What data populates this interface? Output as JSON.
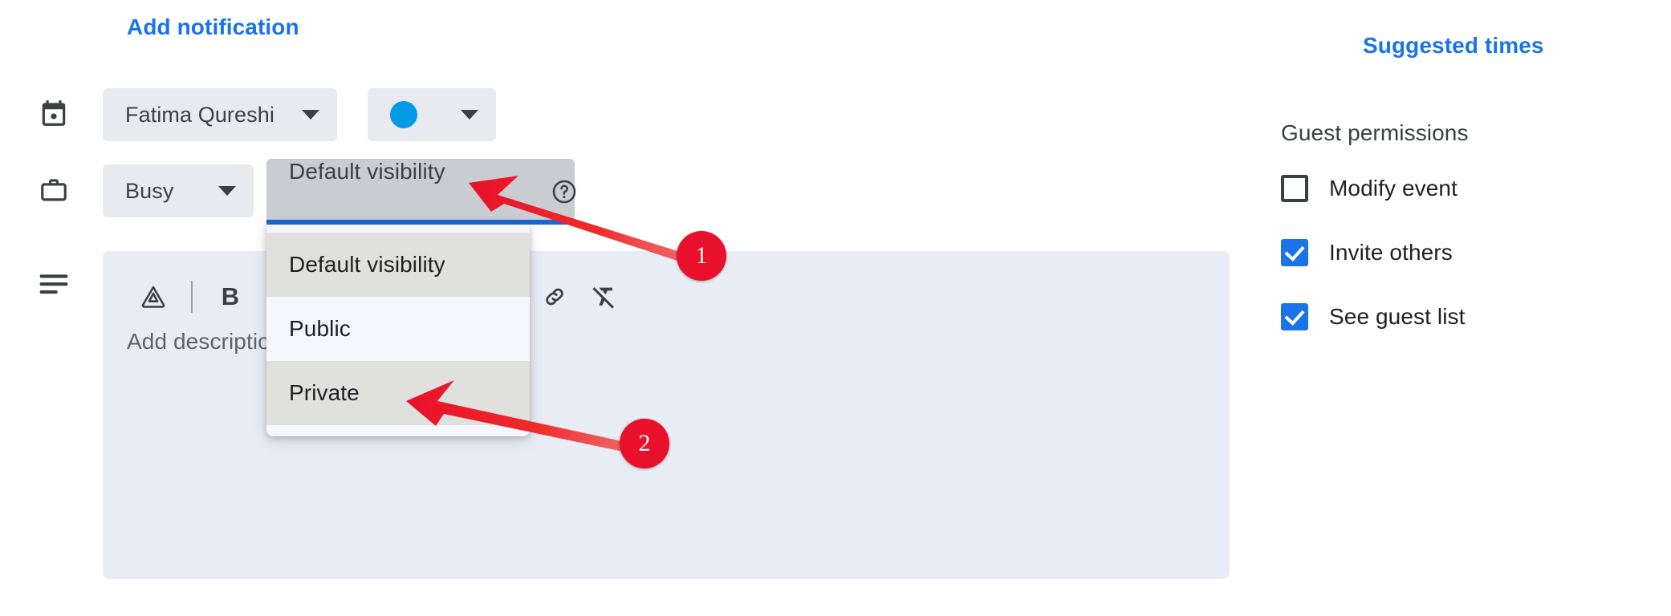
{
  "links": {
    "add_notification": "Add notification",
    "suggested_times": "Suggested times"
  },
  "colors": {
    "accent_blue": "#1a73e8",
    "underline_blue": "#1967d2",
    "chip_bg": "#e8eaf0",
    "active_chip_bg": "#c9ccd1",
    "menu_bg": "#f4f6fb",
    "menu_highlight": "#e0e0dd",
    "swatch": "#039be5",
    "marker_red": "#e8102a",
    "description_bg": "#e8ecf4"
  },
  "icons": {
    "calendar": "calendar-icon",
    "busy": "briefcase-icon",
    "description": "description-lines-icon",
    "help": "help-circle-icon",
    "drive": "google-drive-icon",
    "bold": "bold-icon",
    "link": "link-icon",
    "clear_format": "clear-formatting-icon"
  },
  "owner_select": {
    "value": "Fatima Qureshi",
    "caret": "chevron-down-icon"
  },
  "color_select": {
    "swatch_color": "#039be5",
    "caret": "chevron-down-icon"
  },
  "busy_select": {
    "value": "Busy",
    "caret": "chevron-down-icon"
  },
  "visibility_select": {
    "value": "Default visibility",
    "expanded": true,
    "options": [
      {
        "label": "Default visibility",
        "highlighted": true
      },
      {
        "label": "Public",
        "highlighted": false
      },
      {
        "label": "Private",
        "highlighted": true
      }
    ]
  },
  "editor": {
    "bold_label": "B",
    "placeholder": "Add description"
  },
  "guest_permissions": {
    "title": "Guest permissions",
    "items": [
      {
        "label": "Modify event",
        "checked": false
      },
      {
        "label": "Invite others",
        "checked": true
      },
      {
        "label": "See guest list",
        "checked": true
      }
    ]
  },
  "annotations": [
    {
      "number": "1",
      "target": "visibility-dropdown-button"
    },
    {
      "number": "2",
      "target": "menu-option-private"
    }
  ]
}
